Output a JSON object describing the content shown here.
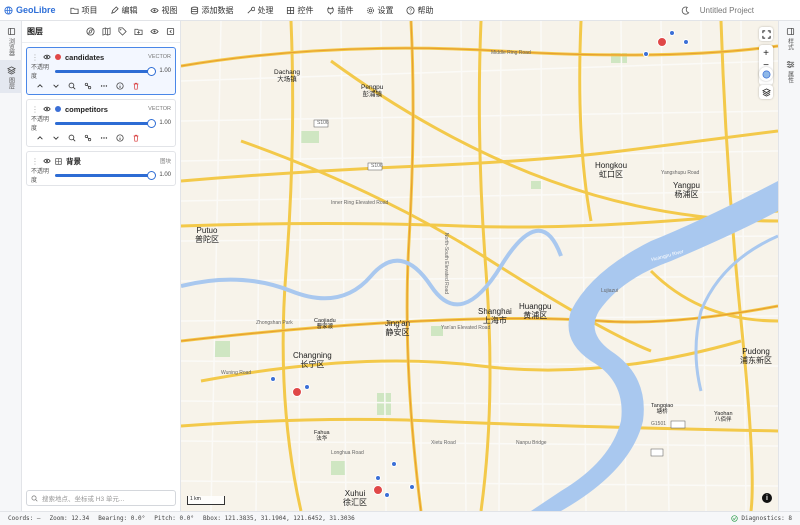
{
  "app": {
    "name": "GeoLibre",
    "project": "Untitled Project"
  },
  "menu": [
    {
      "label": "项目",
      "icon": "folder-icon"
    },
    {
      "label": "编辑",
      "icon": "pencil-icon"
    },
    {
      "label": "视图",
      "icon": "eye-icon"
    },
    {
      "label": "添加数据",
      "icon": "database-icon"
    },
    {
      "label": "处理",
      "icon": "wrench-icon"
    },
    {
      "label": "控件",
      "icon": "grid-icon"
    },
    {
      "label": "插件",
      "icon": "plug-icon"
    },
    {
      "label": "设置",
      "icon": "gear-icon"
    },
    {
      "label": "帮助",
      "icon": "help-icon"
    }
  ],
  "left_rail": {
    "items": [
      {
        "label": "浏览器"
      },
      {
        "label": "图层"
      }
    ]
  },
  "right_rail": {
    "items": [
      {
        "label": "样式"
      },
      {
        "label": "属性"
      }
    ]
  },
  "panel": {
    "title": "图层",
    "opacity_label": "不透明度",
    "layers": [
      {
        "name": "candidates",
        "type": "VECTOR",
        "opacity": "1.00",
        "color": "#e04848",
        "active": true
      },
      {
        "name": "competitors",
        "type": "VECTOR",
        "opacity": "1.00",
        "color": "#3b6fd6",
        "active": false
      },
      {
        "name": "背景",
        "type": "图块",
        "opacity": "1.00",
        "color": "",
        "active": false
      }
    ],
    "search_placeholder": "搜索地点、坐标或 H3 单元..."
  },
  "map": {
    "scale": "1 km",
    "districts": [
      {
        "en": "Putuo",
        "zh": "普陀区"
      },
      {
        "en": "Hongkou",
        "zh": "虹口区"
      },
      {
        "en": "Yangpu",
        "zh": "杨浦区"
      },
      {
        "en": "Jing'an",
        "zh": "静安区"
      },
      {
        "en": "Shanghai",
        "zh": "上海市"
      },
      {
        "en": "Huangpu",
        "zh": "黄浦区"
      },
      {
        "en": "Changning",
        "zh": "长宁区"
      },
      {
        "en": "Pudong",
        "zh": "浦东新区"
      },
      {
        "en": "Xuhui",
        "zh": "徐汇区"
      },
      {
        "en": "Dachang",
        "zh": "大场镇"
      },
      {
        "en": "Pengpu",
        "zh": "彭浦镇"
      },
      {
        "en": "Caojiadu",
        "zh": "曹家渡"
      },
      {
        "en": "Fahua",
        "zh": "法华"
      },
      {
        "en": "Tangqiao",
        "zh": "塘桥"
      },
      {
        "en": "Yaohan",
        "zh": "八佰伴"
      }
    ],
    "roads": [
      "S106",
      "Huangpu River",
      "S106",
      "G1501",
      "Yan'an Elevated Road",
      "Middle Ring Road",
      "Inner Ring Elevated Road",
      "North-South Elevated Road",
      "Wuning Road",
      "Zhongshan Park",
      "Xietu Road",
      "Longhua Road",
      "Nanpu Bridge",
      "Lujiazui",
      "Yangshupu Road"
    ]
  },
  "status": {
    "coords": "Coords: —",
    "zoom": "Zoom: 12.34",
    "bearing": "Bearing: 0.0°",
    "pitch": "Pitch: 0.0°",
    "bbox": "Bbox: 121.3835, 31.1904, 121.6452, 31.3036",
    "diagnostics": "Diagnostics: 8"
  },
  "colors": {
    "accent": "#2d6cd4",
    "candidate": "#e04848",
    "competitor": "#3b6fd6",
    "river": "#a9c8ef",
    "road": "#f6cf62"
  }
}
